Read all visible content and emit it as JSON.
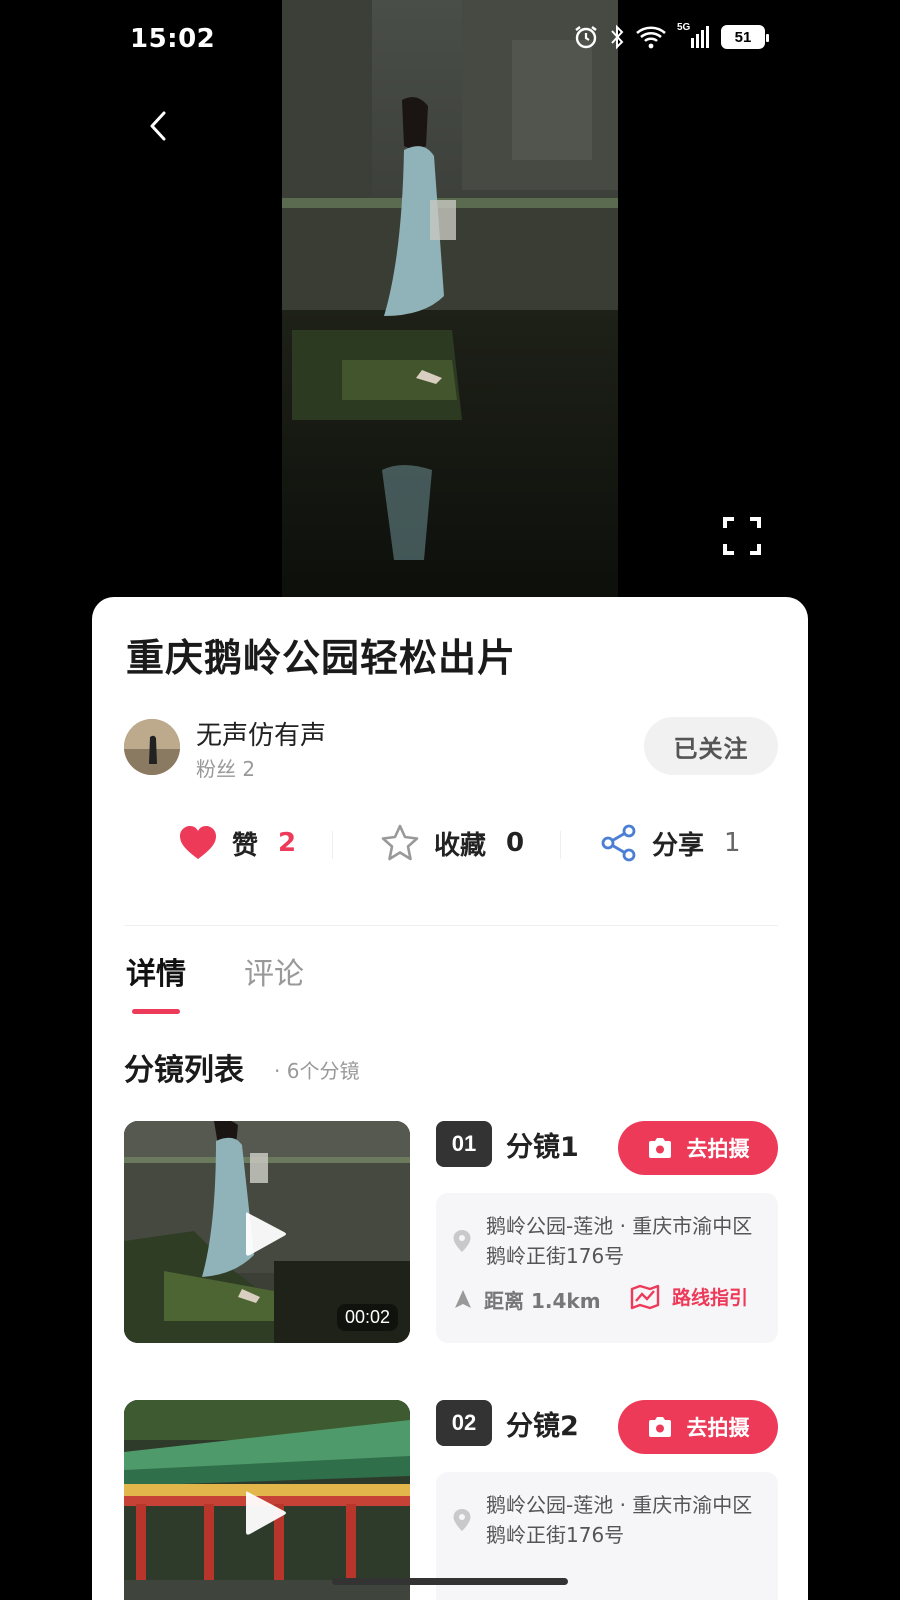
{
  "status_bar": {
    "time": "15:02",
    "battery": "51",
    "network": "5G"
  },
  "post": {
    "title": "重庆鹅岭公园轻松出片",
    "author": {
      "name": "无声仿有声",
      "fans": "粉丝 2"
    },
    "follow_label": "已关注",
    "actions": {
      "like": {
        "label": "赞",
        "count": "2"
      },
      "favorite": {
        "label": "收藏",
        "count": "0"
      },
      "share": {
        "label": "分享",
        "count": "1"
      }
    }
  },
  "tabs": [
    {
      "label": "详情",
      "active": true
    },
    {
      "label": "评论",
      "active": false
    }
  ],
  "section": {
    "title": "分镜列表",
    "subtitle": "· 6个分镜"
  },
  "shots": [
    {
      "number": "01",
      "name": "分镜1",
      "shoot_label": "去拍摄",
      "address": "鹅岭公园-莲池 · 重庆市渝中区鹅岭正街176号",
      "distance": "距离 1.4km",
      "route_label": "路线指引",
      "duration": "00:02"
    },
    {
      "number": "02",
      "name": "分镜2",
      "shoot_label": "去拍摄",
      "address": "鹅岭公园-莲池 · 重庆市渝中区鹅岭正街176号"
    }
  ],
  "colors": {
    "accent": "#ee3a59",
    "card_bg": "#ffffff",
    "page_bg": "#000000"
  },
  "icons": [
    "back-icon",
    "fullscreen-icon",
    "heart-icon",
    "star-icon",
    "share-icon",
    "camera-icon",
    "play-icon",
    "location-pin-icon",
    "navigation-arrow-icon",
    "route-map-icon",
    "alarm-icon",
    "bluetooth-icon",
    "wifi-icon",
    "cellular-signal-icon",
    "battery-icon"
  ]
}
